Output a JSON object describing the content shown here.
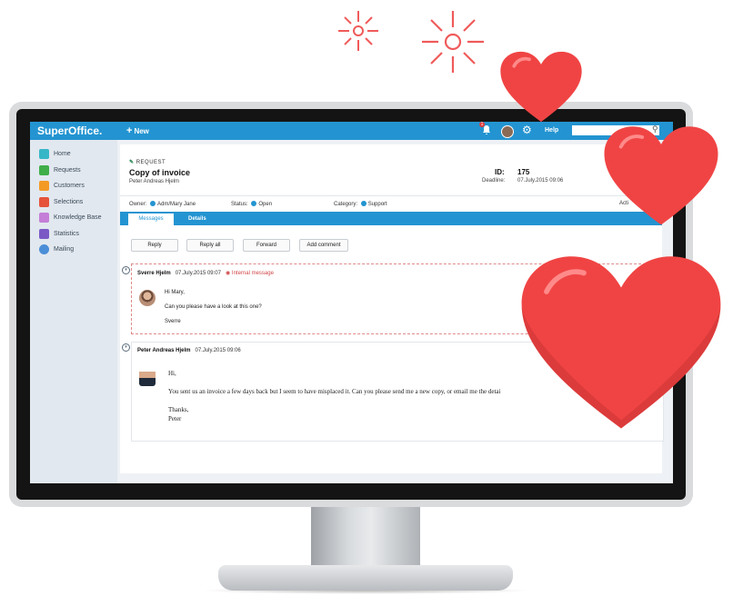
{
  "colors": {
    "brand": "#2394d1",
    "heart": "#f04444",
    "sparkle": "#f05a5a",
    "internal": "#d04545"
  },
  "app": {
    "logo": "SuperOffice.",
    "new_label": "New",
    "notification_count": "1",
    "help_label": "Help"
  },
  "sidebar": {
    "items": [
      {
        "label": "Home",
        "icon": "home-icon",
        "color": "#35b6c7"
      },
      {
        "label": "Requests",
        "icon": "requests-icon",
        "color": "#3fae49"
      },
      {
        "label": "Customers",
        "icon": "customers-icon",
        "color": "#f39a25"
      },
      {
        "label": "Selections",
        "icon": "selections-icon",
        "color": "#e5533a"
      },
      {
        "label": "Knowledge Base",
        "icon": "knowledge-base-icon",
        "color": "#c57ed8"
      },
      {
        "label": "Statistics",
        "icon": "statistics-icon",
        "color": "#7a59c5"
      },
      {
        "label": "Mailing",
        "icon": "mailing-icon",
        "color": "#4b8ed8"
      }
    ]
  },
  "request": {
    "tag": "REQUEST",
    "title": "Copy of invoice",
    "contact": "Peter Andreas Hjelm",
    "id_label": "ID:",
    "id_value": "175",
    "deadline_label": "Deadline:",
    "deadline_value": "07.July.2015 09:06",
    "owner_label": "Owner:",
    "owner_value": "Adm/Mary Jane",
    "status_label": "Status:",
    "status_value": "Open",
    "category_label": "Category:",
    "category_value": "Support",
    "activity_label": "Acti"
  },
  "tabs": [
    "Messages",
    "Details"
  ],
  "actions": [
    "Reply",
    "Reply all",
    "Forward",
    "Add comment"
  ],
  "messages": [
    {
      "author": "Sverre Hjelm",
      "date": "07.July.2015 09:07",
      "flag": "Internal message",
      "lines": [
        "Hi Mary,",
        "Can you please have a look at this one?",
        "Sverre"
      ]
    },
    {
      "author": "Peter Andreas Hjelm",
      "date": "07.July.2015 09:06",
      "lines": [
        "Hi,",
        "You sent us an invoice a few days back but I seem to have misplaced it. Can you please send me a new copy, or email me the detai",
        "Thanks,",
        "Peter"
      ]
    }
  ]
}
